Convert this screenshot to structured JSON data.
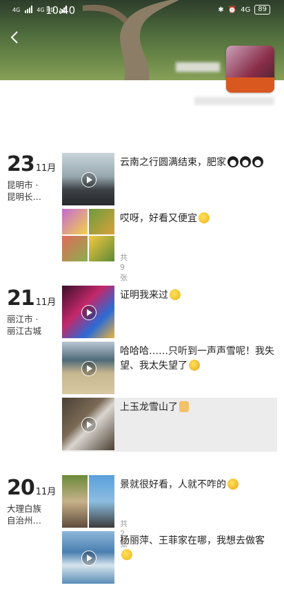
{
  "status_bar": {
    "network_1": "4G",
    "network_2": "4G HD",
    "time": "10:40",
    "network_right": "4G",
    "battery": "89"
  },
  "days": [
    {
      "day": "23",
      "month": "11月",
      "location_1": "昆明市 ·",
      "location_2": "昆明长…"
    },
    {
      "day": "21",
      "month": "11月",
      "location_1": "丽江市 ·",
      "location_2": "丽江古城"
    },
    {
      "day": "20",
      "month": "11月",
      "location_1": "大理白族",
      "location_2": "自治州…"
    }
  ],
  "posts": [
    {
      "text": "云南之行圆满结束，肥家",
      "emoji": "penguin-emoji",
      "count": ""
    },
    {
      "text": "哎呀，好看又便宜",
      "emoji": "thinking-emoji",
      "count": "共9张"
    },
    {
      "text": "证明我来过",
      "emoji": "thinking-emoji",
      "count": ""
    },
    {
      "text": "哈哈哈……只听到一声声雪呢！我失望、我太失望了",
      "emoji": "crying-laughing-emoji",
      "count": ""
    },
    {
      "text": "上玉龙雪山了",
      "emoji": "victory-emoji",
      "count": ""
    },
    {
      "text": "景就很好看，人就不咋的",
      "emoji": "laughing-emoji",
      "count": "共2张"
    },
    {
      "text": "杨丽萍、王菲家在哪，我想去做客",
      "emoji": "thinking-emoji",
      "count": ""
    }
  ],
  "colors": {
    "cover_accent": "#4d6a3c",
    "avatar": "#8b2e4a"
  }
}
